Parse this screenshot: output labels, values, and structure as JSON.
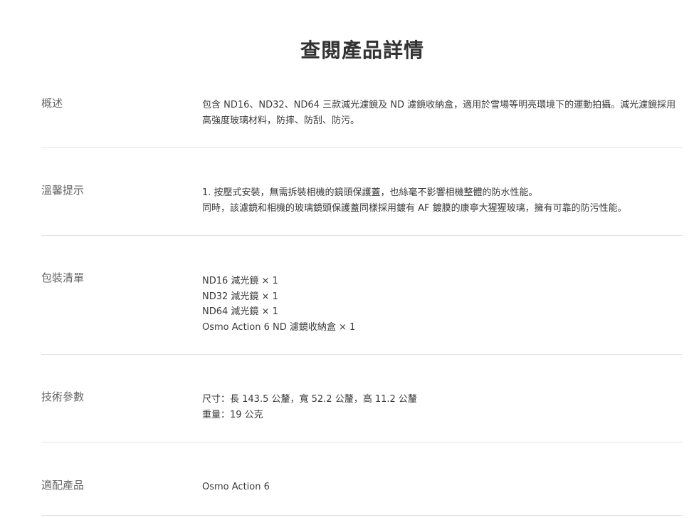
{
  "page": {
    "title": "查閱產品詳情"
  },
  "specs": {
    "overview": {
      "label": "概述",
      "lines": [
        "包含 ND16、ND32、ND64 三款減光濾鏡及 ND 濾鏡收納盒，適用於雪場等明亮環境下的運動拍攝。減光濾鏡採用高強度玻璃材料，防摔、防刮、防污。"
      ]
    },
    "tips": {
      "label": "溫馨提示",
      "lines": [
        "1. 按壓式安裝，無需拆裝相機的鏡頭保護蓋，也絲毫不影響相機整體的防水性能。",
        "同時，該濾鏡和相機的玻璃鏡頭保護蓋同樣採用鍍有 AF 鍍膜的康寧大猩猩玻璃，擁有可靠的防污性能。"
      ]
    },
    "package": {
      "label": "包裝清單",
      "lines": [
        "ND16 減光鏡 × 1",
        "ND32 減光鏡 × 1",
        "ND64 減光鏡 × 1",
        "Osmo Action 6 ND 濾鏡收納盒 × 1"
      ]
    },
    "tech": {
      "label": "技術參數",
      "lines": [
        "尺寸：長 143.5 公釐，寬 52.2 公釐，高 11.2 公釐",
        "重量：19 公克"
      ]
    },
    "compat": {
      "label": "適配產品",
      "lines": [
        "Osmo Action 6"
      ]
    }
  }
}
